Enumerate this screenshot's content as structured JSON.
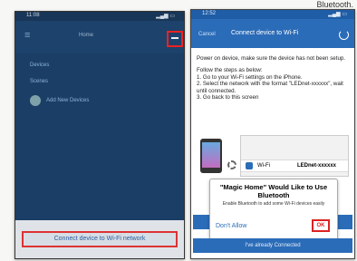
{
  "top_text": "Bluetooth.",
  "left_phone": {
    "status_time": "11:08",
    "header_title": "Home",
    "plus_label": "+",
    "list_rows": [
      "Devices",
      "Scenes",
      "Add New Devices"
    ],
    "connect_button": "Connect device to Wi-Fi network"
  },
  "right_phone": {
    "status_time": "12:52",
    "cancel": "Cancel",
    "title": "Connect device to Wi-Fi",
    "intro": "Power on device, make sure the device has not been setup.",
    "steps_header": "Follow the steps as below:",
    "steps": [
      "1. Go to your Wi-Fi settings on the iPhone.",
      "2. Select the network with the format \"LEDnet-xxxxxx\", wait until connected.",
      "3. Go back to this screen"
    ],
    "wifi_label": "Wi-Fi",
    "wifi_network": "LEDnet-xxxxxx",
    "alert_title": "\"Magic Home\" Would Like to Use Bluetooth",
    "alert_message": "Enable Bluetooth to add some Wi-Fi devices easily",
    "dont_allow": "Don't Allow",
    "ok": "OK",
    "bottom_button": "I've already Connected"
  }
}
